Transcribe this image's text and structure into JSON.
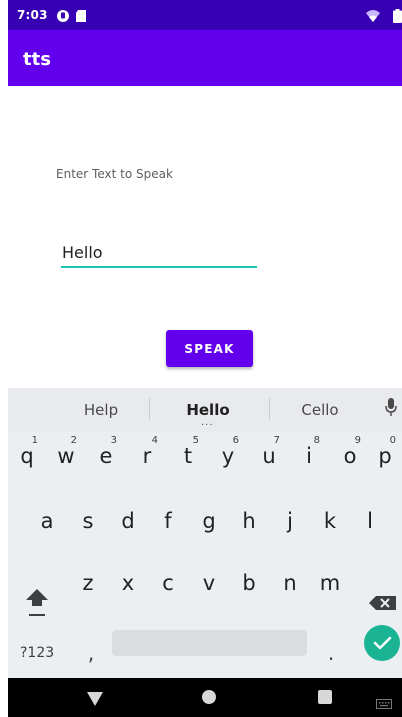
{
  "status_bar": {
    "time": "7:03"
  },
  "app_bar": {
    "title": "tts"
  },
  "main": {
    "prompt_label": "Enter Text to Speak",
    "text_input_value": "Hello",
    "speak_button_label": "SPEAK"
  },
  "keyboard": {
    "suggestions": [
      "Help",
      "Hello",
      "Cello"
    ],
    "more_indicator": "...",
    "row1": [
      {
        "key": "q",
        "hint": "1"
      },
      {
        "key": "w",
        "hint": "2"
      },
      {
        "key": "e",
        "hint": "3"
      },
      {
        "key": "r",
        "hint": "4"
      },
      {
        "key": "t",
        "hint": "5"
      },
      {
        "key": "y",
        "hint": "6"
      },
      {
        "key": "u",
        "hint": "7"
      },
      {
        "key": "i",
        "hint": "8"
      },
      {
        "key": "o",
        "hint": "9"
      },
      {
        "key": "p",
        "hint": "0"
      }
    ],
    "row2": [
      "a",
      "s",
      "d",
      "f",
      "g",
      "h",
      "j",
      "k",
      "l"
    ],
    "row3": [
      "z",
      "x",
      "c",
      "v",
      "b",
      "n",
      "m"
    ],
    "symbols_label": "?123",
    "comma_label": ",",
    "period_label": "."
  },
  "colors": {
    "status_bar": "#3700b3",
    "app_bar": "#6200ee",
    "accent": "#1ac5b5",
    "enter_key": "#1ab394"
  }
}
